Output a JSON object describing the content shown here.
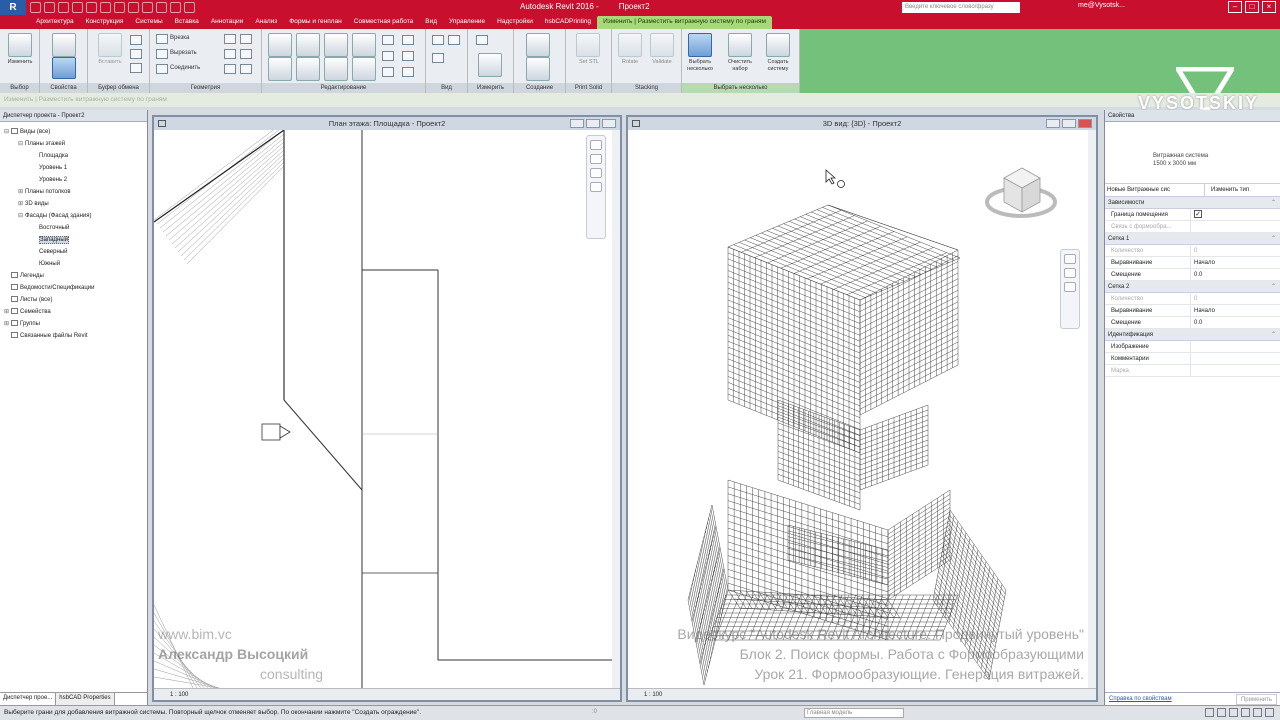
{
  "app": {
    "logo": "R",
    "title": "Autodesk Revit 2016 -",
    "project": "Проект2",
    "search_placeholder": "Введите ключевое слово/фразу",
    "user": "me@Vysotsk...",
    "win_min": "–",
    "win_max": "□",
    "win_close": "×"
  },
  "tabs": [
    "Архитектура",
    "Конструкция",
    "Системы",
    "Вставка",
    "Аннотации",
    "Анализ",
    "Формы и генплан",
    "Совместная работа",
    "Вид",
    "Управление",
    "Надстройки",
    "hsbCADPrinting",
    "Изменить | Разместить витражную систему по граням"
  ],
  "ribbon": {
    "panels": {
      "select": "Выбор",
      "properties": "Свойства",
      "clipboard": "Буфер обмена",
      "geometry": "Геометрия",
      "modify": "Редактирование",
      "view": "Вид",
      "measure": "Измерить",
      "create": "Создание",
      "print": "Print Solid",
      "stacking": "Stacking",
      "multiselect": "Выбрать несколько"
    },
    "buttons": {
      "modify": "Изменить",
      "paste": "Вставить",
      "cut": "Врезка",
      "cut_out": "Вырезать",
      "join": "Соединить",
      "set_stl": "Set STL",
      "rotate": "Rotate",
      "validate": "Validate",
      "select_multiple": "Выбрать несколько",
      "clear_selection": "Очистить набор",
      "create_system": "Создать систему"
    }
  },
  "options_bar": "Изменить | Разместить витражную систему по граням",
  "brand": "VYSOTSKIY",
  "project_browser": {
    "title": "Диспетчер проекта - Проект2",
    "nodes": [
      {
        "label": "Виды (все)",
        "level": 0,
        "toggle": "⊟"
      },
      {
        "label": "Планы этажей",
        "level": 1,
        "toggle": "⊟"
      },
      {
        "label": "Площадка",
        "level": 2,
        "toggle": ""
      },
      {
        "label": "Уровень 1",
        "level": 2,
        "toggle": ""
      },
      {
        "label": "Уровень 2",
        "level": 2,
        "toggle": ""
      },
      {
        "label": "Планы потолков",
        "level": 1,
        "toggle": "⊞"
      },
      {
        "label": "3D виды",
        "level": 1,
        "toggle": "⊞"
      },
      {
        "label": "Фасады (Фасад здания)",
        "level": 1,
        "toggle": "⊟"
      },
      {
        "label": "Восточный",
        "level": 2,
        "toggle": ""
      },
      {
        "label": "Западный",
        "level": 2,
        "toggle": "",
        "selected": true
      },
      {
        "label": "Северный",
        "level": 2,
        "toggle": ""
      },
      {
        "label": "Южный",
        "level": 2,
        "toggle": ""
      },
      {
        "label": "Легенды",
        "level": 0,
        "toggle": ""
      },
      {
        "label": "Ведомости/Спецификации",
        "level": 0,
        "toggle": ""
      },
      {
        "label": "Листы (все)",
        "level": 0,
        "toggle": ""
      },
      {
        "label": "Семейства",
        "level": 0,
        "toggle": "⊞"
      },
      {
        "label": "Группы",
        "level": 0,
        "toggle": "⊞"
      },
      {
        "label": "Связанные файлы Revit",
        "level": 0,
        "toggle": ""
      }
    ],
    "tabs": [
      "Диспетчер прое...",
      "hsbCAD Properties"
    ]
  },
  "view_plan": {
    "title": "План этажа: Площадка - Проект2",
    "scale": "1 : 100"
  },
  "view_3d": {
    "title": "3D вид: {3D} - Проект2",
    "scale": "1 : 100"
  },
  "properties": {
    "title": "Свойства",
    "family": "Витражная система",
    "type": "1500 x 3000 мм",
    "instance_selector": "Новые Витражные сис",
    "edit_type": "Изменить тип",
    "groups": [
      {
        "name": "Зависимости",
        "rows": [
          {
            "k": "Граница помещения",
            "v": "✓",
            "check": true
          },
          {
            "k": "Связь с формообра...",
            "v": "",
            "disabled": true
          }
        ]
      },
      {
        "name": "Сетка 1",
        "rows": [
          {
            "k": "Количество",
            "v": "0",
            "disabled": true
          },
          {
            "k": "Выравнивание",
            "v": "Начало"
          },
          {
            "k": "Смещение",
            "v": "0.0"
          }
        ]
      },
      {
        "name": "Сетка 2",
        "rows": [
          {
            "k": "Количество",
            "v": "0",
            "disabled": true
          },
          {
            "k": "Выравнивание",
            "v": "Начало"
          },
          {
            "k": "Смещение",
            "v": "0.0"
          }
        ]
      },
      {
        "name": "Идентификация",
        "rows": [
          {
            "k": "Изображение",
            "v": ""
          },
          {
            "k": "Комментарии",
            "v": ""
          },
          {
            "k": "Марка",
            "v": "",
            "disabled": true
          }
        ]
      }
    ],
    "help_link": "Справка по свойствам",
    "apply": "Применить"
  },
  "status": {
    "text": "Выберите грани для добавления витражной системы. Повторный щелчок отменяет выбор. По окончании нажмите \"Создать ограждение\".",
    "zero": ":0",
    "model": "Главная модель"
  },
  "watermark": {
    "site": "www.bim.vc",
    "author": "Александр Высоцкий",
    "company": "consulting",
    "course_line1": "Видеокурс \"Autodesk Revit Architecture. Продвинутый уровень\"",
    "course_line2": "Блок 2. Поиск формы. Работа с Формообразующими",
    "course_line3": "Урок 21. Формообразующие. Генерация витражей."
  },
  "colors": {
    "title_bar": "#c8102e",
    "context_tab": "#73c17b",
    "view_border": "#7f8fa4"
  }
}
